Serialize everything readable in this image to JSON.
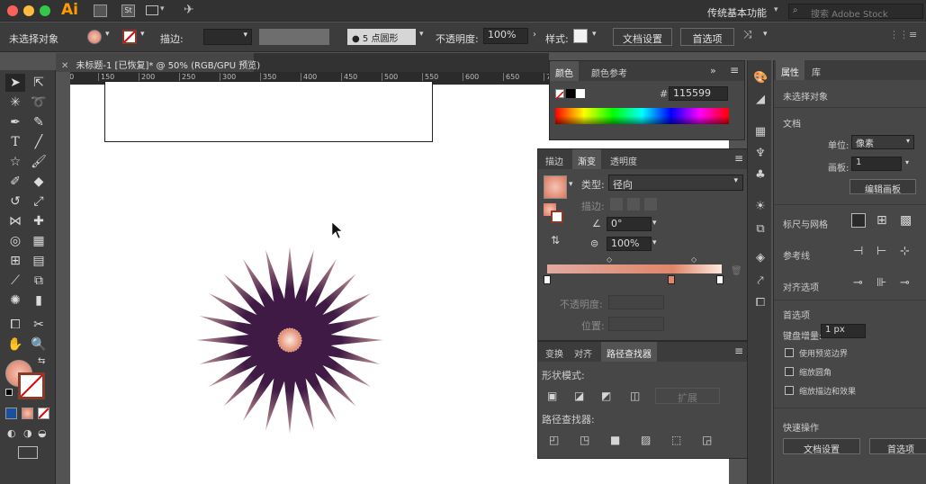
{
  "menubar": {
    "app_logo": "Ai",
    "workspace": "传统基本功能",
    "search_placeholder": "搜索 Adobe Stock"
  },
  "control": {
    "selection_label": "未选择对象",
    "stroke_label": "描边:",
    "brush_label": "5 点圆形",
    "opacity_label": "不透明度:",
    "opacity_value": "100%",
    "style_label": "样式:",
    "doc_setup": "文档设置",
    "preferences": "首选项"
  },
  "document": {
    "tab_title": "未标题-1 [已恢复]* @ 50% (RGB/GPU 预览)"
  },
  "ruler": {
    "marks": [
      "100",
      "150",
      "200",
      "250",
      "300",
      "350",
      "400",
      "450",
      "500",
      "550",
      "600",
      "650",
      "700",
      "750",
      "800",
      "850",
      "900",
      "950"
    ]
  },
  "color_panel": {
    "tabs": [
      "颜色",
      "颜色参考"
    ],
    "hex_label": "#",
    "hex_value": "115599"
  },
  "gradient_panel": {
    "tabs": [
      "描边",
      "渐变",
      "透明度"
    ],
    "type_label": "类型:",
    "type_value": "径向",
    "stroke_label": "描边:",
    "angle_value": "0°",
    "aspect_value": "100%",
    "opacity_label": "不透明度:",
    "location_label": "位置:",
    "gradient_start": "#e2aaa0",
    "gradient_end": "#fde9de"
  },
  "pathfinder_panel": {
    "tabs": [
      "变换",
      "对齐",
      "路径查找器"
    ],
    "shape_modes_label": "形状模式:",
    "expand_label": "扩展",
    "pathfinders_label": "路径查找器:"
  },
  "properties_panel": {
    "tabs": [
      "属性",
      "库"
    ],
    "no_selection": "未选择对象",
    "document_heading": "文档",
    "units_label": "单位:",
    "units_value": "像素",
    "artboard_label": "画板:",
    "artboard_value": "1",
    "edit_artboard": "编辑画板",
    "rulers_grids": "标尺与网格",
    "guides": "参考线",
    "snap_options": "对齐选项",
    "preferences_heading": "首选项",
    "keyboard_increment_label": "键盘增量:",
    "keyboard_increment_value": "1 px",
    "use_preview_bounds": "使用预览边界",
    "scale_corners": "缩放圆角",
    "scale_strokes": "缩放描边和效果",
    "quick_actions": "快速操作",
    "doc_setup_btn": "文档设置",
    "preferences_btn": "首选项"
  },
  "colors": {
    "star_fill": "#3f1a44",
    "star_edge": "#c79a9a",
    "accent": "#e0866a",
    "fill_swatch": "#d9765d"
  }
}
